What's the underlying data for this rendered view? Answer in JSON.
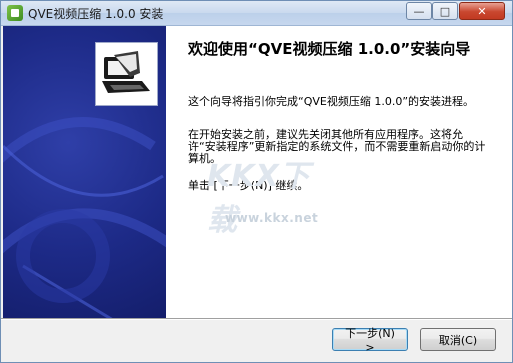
{
  "window": {
    "title": "QVE视频压缩 1.0.0 安装",
    "controls": {
      "minimize": "—",
      "maximize": "□",
      "close": "✕"
    }
  },
  "content": {
    "heading": "欢迎使用“QVE视频压缩 1.0.0”安装向导",
    "paragraph1": "这个向导将指引你完成“QVE视频压缩 1.0.0”的安装进程。",
    "paragraph2": "在开始安装之前，建议先关闭其他所有应用程序。这将允许“安装程序”更新指定的系统文件，而不需要重新启动你的计算机。",
    "paragraph3": "单击 [下一步(N)] 继续。"
  },
  "watermark": {
    "logo": "KKX下载",
    "url": "www.kkx.net"
  },
  "buttons": {
    "next": "下一步(N) >",
    "cancel": "取消(C)"
  },
  "colors": {
    "sidebar": "#1d2a87",
    "accent": "#3c7fb1"
  },
  "icons": {
    "app": "app-icon",
    "installer": "installer-computer-icon"
  }
}
